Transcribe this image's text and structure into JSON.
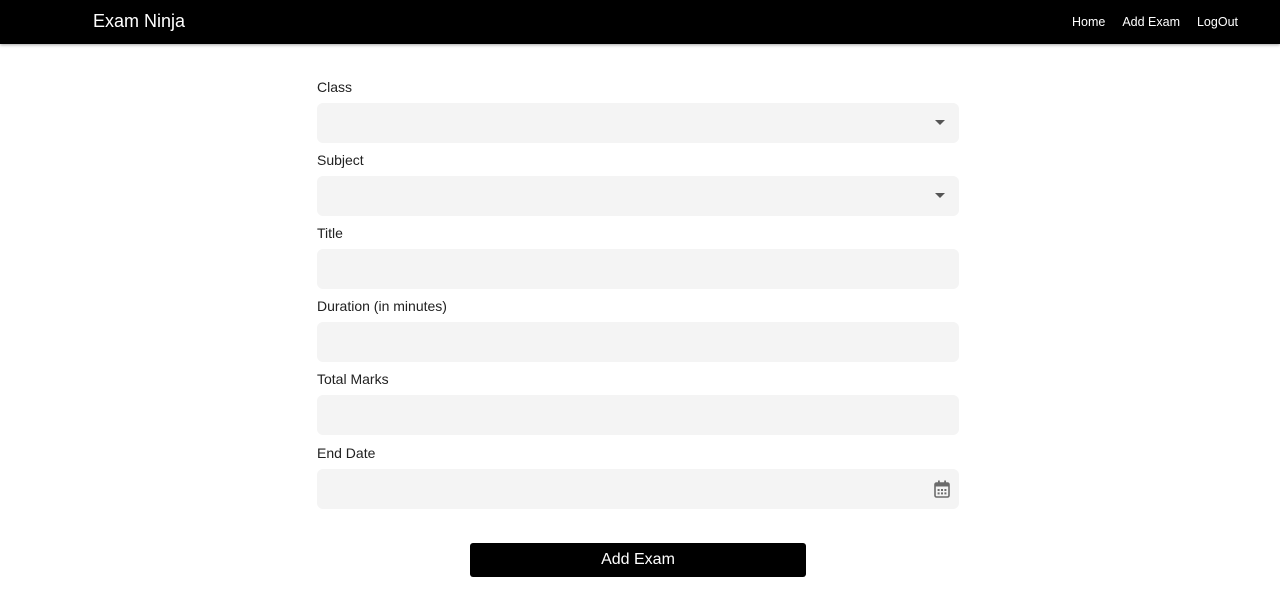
{
  "navbar": {
    "brand": "Exam Ninja",
    "links": [
      {
        "label": "Home"
      },
      {
        "label": "Add Exam"
      },
      {
        "label": "LogOut"
      }
    ]
  },
  "form": {
    "class_label": "Class",
    "class_value": "",
    "subject_label": "Subject",
    "subject_value": "",
    "title_label": "Title",
    "title_value": "",
    "duration_label": "Duration (in minutes)",
    "duration_value": "",
    "total_marks_label": "Total Marks",
    "total_marks_value": "",
    "end_date_label": "End Date",
    "end_date_value": "",
    "submit_label": "Add Exam"
  },
  "colors": {
    "navbar_bg": "#000000",
    "field_bg": "#f4f4f4",
    "button_bg": "#000000",
    "text": "#212121"
  },
  "icons": {
    "select_caret": "caret-down-icon",
    "date_picker": "calendar-icon"
  }
}
